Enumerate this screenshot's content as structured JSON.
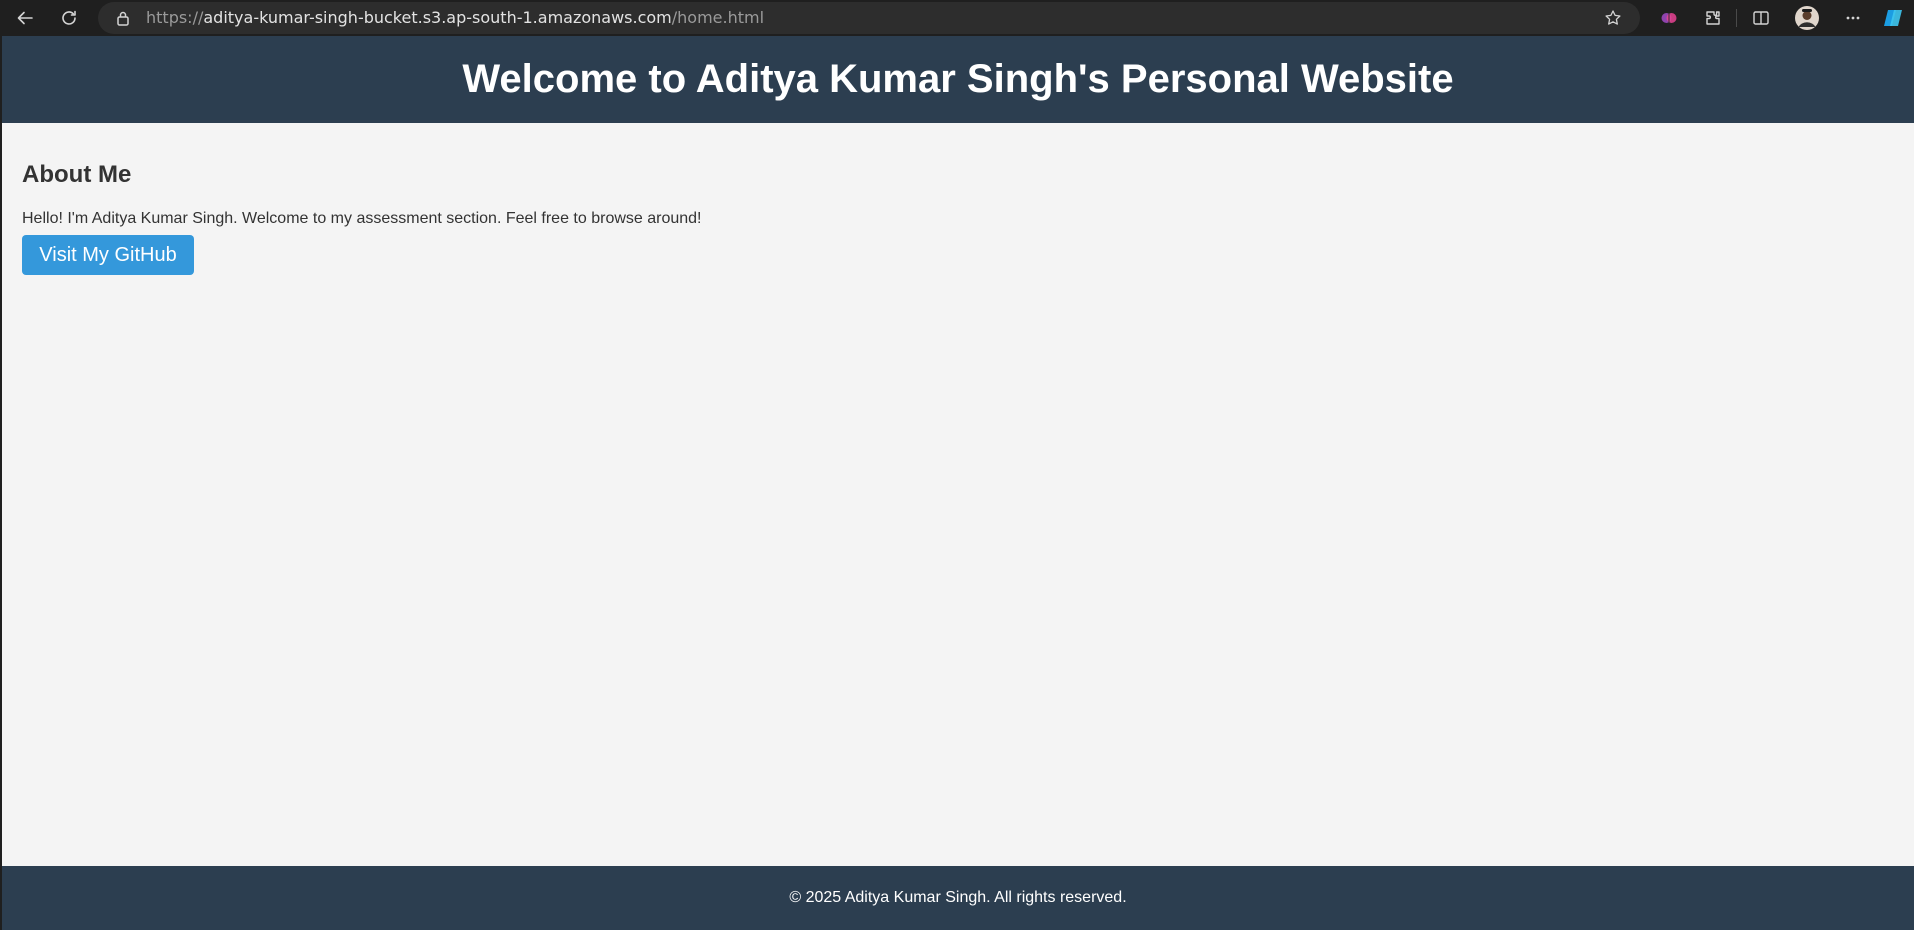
{
  "browser": {
    "url_scheme": "https://",
    "url_host": "aditya-kumar-singh-bucket.s3.ap-south-1.amazonaws.com",
    "url_path": "/home.html",
    "icons": [
      "back-icon",
      "reload-icon",
      "lock-icon",
      "star-icon",
      "extension-brain-icon",
      "extensions-icon",
      "split-screen-icon",
      "profile-avatar",
      "more-icon",
      "copilot-icon"
    ]
  },
  "header": {
    "title": "Welcome to Aditya Kumar Singh's Personal Website"
  },
  "about": {
    "heading": "About Me",
    "text": "Hello! I'm Aditya Kumar Singh. Welcome to my assessment section. Feel free to browse around!",
    "button_label": "Visit My GitHub"
  },
  "footer": {
    "text": "© 2025 Aditya Kumar Singh. All rights reserved."
  },
  "colors": {
    "header_bg": "#2c3e50",
    "page_bg": "#f4f4f4",
    "button_bg": "#3498db",
    "toolbar_bg": "#1f1f1f"
  }
}
